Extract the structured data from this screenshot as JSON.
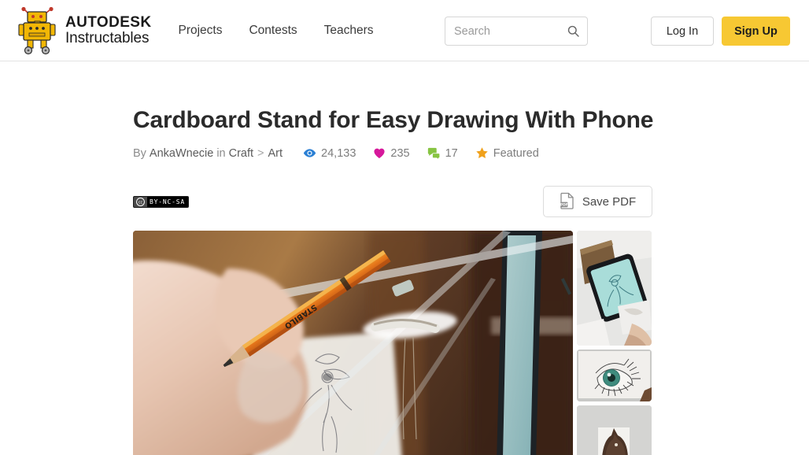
{
  "header": {
    "brand": {
      "line1": "AUTODESK",
      "line2": "Instructables",
      "logo_icon": "autodesk-robot-logo"
    },
    "nav": [
      {
        "label": "Projects"
      },
      {
        "label": "Contests"
      },
      {
        "label": "Teachers"
      }
    ],
    "search": {
      "placeholder": "Search",
      "value": "",
      "icon": "search-icon"
    },
    "login_label": "Log In",
    "signup_label": "Sign Up",
    "signup_color": "#f7c833"
  },
  "article": {
    "title": "Cardboard Stand for Easy Drawing With Phone",
    "byline": {
      "by_word": "By",
      "author": "AnkaWnecie",
      "in_word": "in",
      "category": "Craft",
      "separator": ">",
      "subcategory": "Art"
    },
    "stats": [
      {
        "icon": "eye-icon",
        "value": "24,133",
        "color": "#2a7fd4"
      },
      {
        "icon": "heart-icon",
        "value": "235",
        "color": "#d6189b"
      },
      {
        "icon": "comment-icon",
        "value": "17",
        "color": "#87c442"
      },
      {
        "icon": "star-icon",
        "value": "Featured",
        "color": "#f0a11b"
      }
    ],
    "license": {
      "cc_symbol": "CC",
      "terms": "BY-NC-SA"
    },
    "save_pdf": {
      "label": "Save PDF",
      "icon": "pdf-file-icon",
      "icon_label": "PDF"
    },
    "gallery": {
      "hero_alt": "hand-holding-pencil-drawing-with-phone-stand",
      "thumbs": [
        {
          "alt": "phone-on-cardboard-stand"
        },
        {
          "alt": "pencil-drawing-of-green-eye"
        },
        {
          "alt": "cat-silhouette-drawing"
        }
      ]
    }
  }
}
